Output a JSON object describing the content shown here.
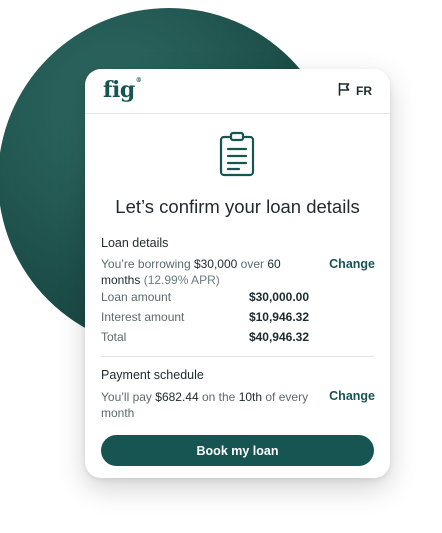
{
  "header": {
    "logo_text": "fig",
    "language_toggle": "FR"
  },
  "title": "Let’s confirm your loan details",
  "loan_details": {
    "heading": "Loan details",
    "summary_prefix": "You’re borrowing ",
    "summary_amount": "$30,000",
    "summary_mid": " over ",
    "summary_term": "60 months",
    "summary_apr": " (12.99% APR)",
    "change_label": "Change",
    "rows": [
      {
        "label": "Loan amount",
        "value": "$30,000.00"
      },
      {
        "label": "Interest amount",
        "value": "$10,946.32"
      },
      {
        "label": "Total",
        "value": "$40,946.32"
      }
    ]
  },
  "payment_schedule": {
    "heading": "Payment schedule",
    "summary_prefix": "You’ll pay ",
    "summary_amount": "$682.44",
    "summary_mid": " on the ",
    "summary_day": "10th",
    "summary_suffix": " of every month",
    "change_label": "Change"
  },
  "cta": {
    "label": "Book my loan"
  },
  "colors": {
    "brand": "#175553",
    "background_circle": "#1d4e4a",
    "text_primary": "#1f2a2e",
    "text_secondary": "#5d6a6c"
  },
  "icons": {
    "flag": "flag-icon",
    "document": "clipboard-icon"
  }
}
